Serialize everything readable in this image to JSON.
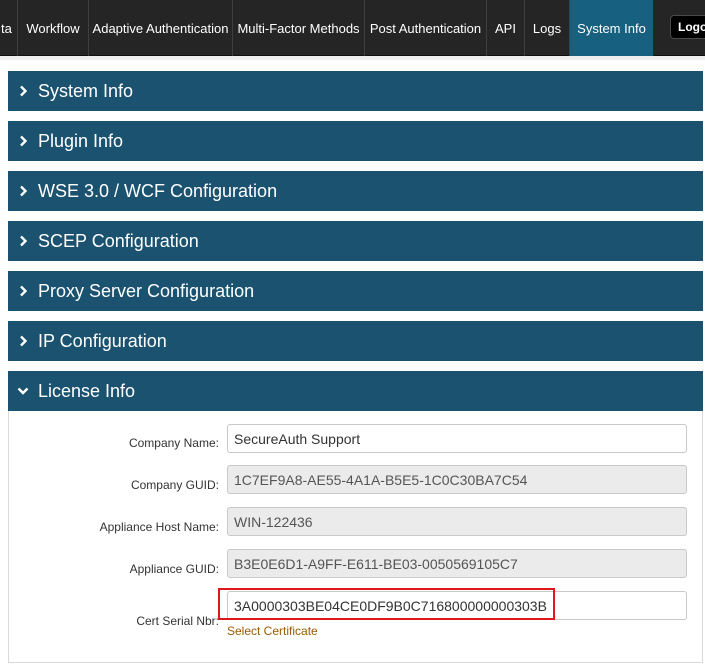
{
  "nav": {
    "tabs": [
      {
        "label": "ta"
      },
      {
        "label": "Workflow"
      },
      {
        "label": "Adaptive Authentication"
      },
      {
        "label": "Multi-Factor Methods"
      },
      {
        "label": "Post Authentication"
      },
      {
        "label": "API"
      },
      {
        "label": "Logs"
      },
      {
        "label": "System Info",
        "active": true
      }
    ],
    "logout_label": "Logout",
    "active_color": "#17607f"
  },
  "sections": [
    {
      "title": "System Info",
      "expanded": false
    },
    {
      "title": "Plugin Info",
      "expanded": false
    },
    {
      "title": "WSE 3.0 / WCF Configuration",
      "expanded": false
    },
    {
      "title": "SCEP Configuration",
      "expanded": false
    },
    {
      "title": "Proxy Server Configuration",
      "expanded": false
    },
    {
      "title": "IP Configuration",
      "expanded": false
    },
    {
      "title": "License Info",
      "expanded": true
    }
  ],
  "license": {
    "fields": [
      {
        "label": "Company Name:",
        "value": "SecureAuth Support",
        "readonly": false
      },
      {
        "label": "Company GUID:",
        "value": "1C7EF9A8-AE55-4A1A-B5E5-1C0C30BA7C54",
        "readonly": true
      },
      {
        "label": "Appliance Host Name:",
        "value": "WIN-122436",
        "readonly": true
      },
      {
        "label": "Appliance GUID:",
        "value": "B3E0E6D1-A9FF-E611-BE03-0050569105C7",
        "readonly": true
      },
      {
        "label": "Cert Serial Nbr:",
        "value": "3A0000303BE04CE0DF9B0C716800000000303B",
        "readonly": false
      }
    ],
    "select_certificate_label": "Select Certificate"
  },
  "colors": {
    "nav_bg": "#252525",
    "section_header_bg": "#1a5270",
    "highlight_border": "#e0161f",
    "link_color": "#9a5a00"
  }
}
